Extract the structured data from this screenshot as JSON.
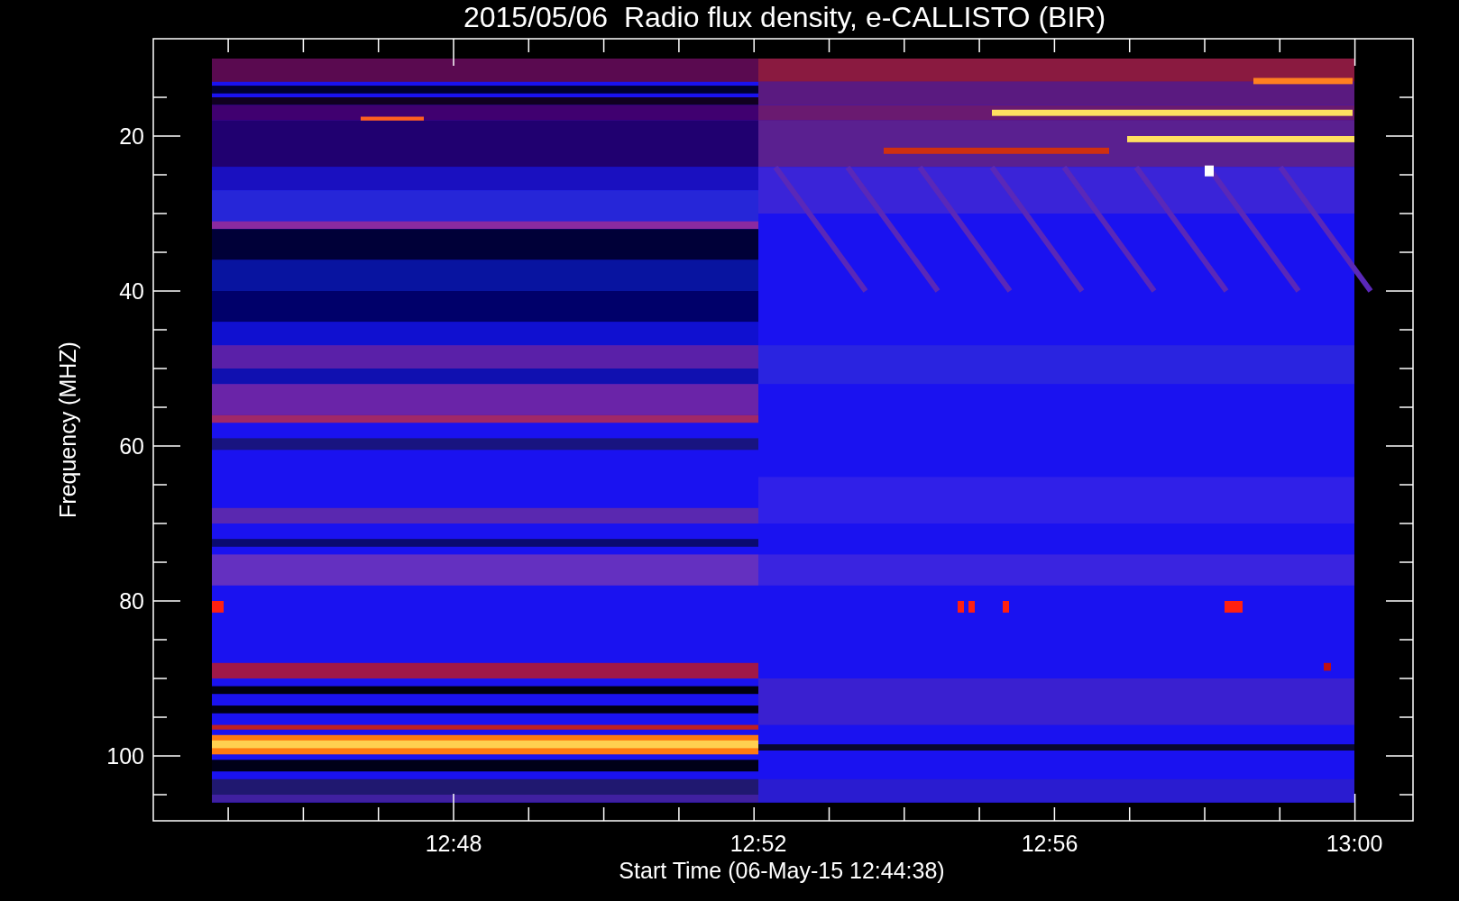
{
  "title": "2015/05/06  Radio flux density, e-CALLISTO (BIR)",
  "y_axis": {
    "label": "Frequency (MHZ)",
    "tick_labels": [
      "20",
      "40",
      "60",
      "80",
      "100"
    ]
  },
  "x_axis": {
    "label": "Start Time (06-May-15 12:44:38)",
    "tick_labels": [
      "12:48",
      "12:52",
      "12:56",
      "13:00"
    ]
  }
}
